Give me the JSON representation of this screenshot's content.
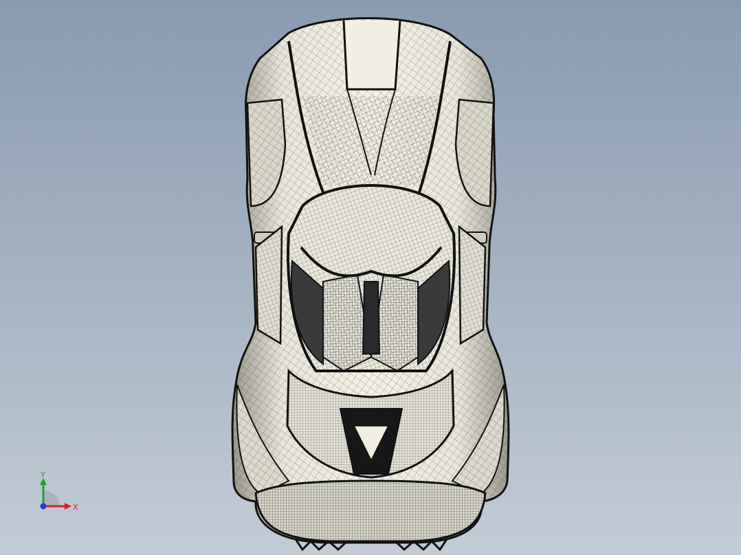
{
  "viewport": {
    "background_top": "#8a9bb0",
    "background_bottom": "#c3ccd6",
    "model_fill": "#e6e4d8",
    "model_edge": "#111111",
    "mesh_color": "#2a2a2a"
  },
  "triad": {
    "x_label": "X",
    "y_label": "Y",
    "x_color": "#d8202a",
    "y_color": "#1fa030",
    "z_color": "#2040d0",
    "icon": "coordinate-triad-icon"
  }
}
